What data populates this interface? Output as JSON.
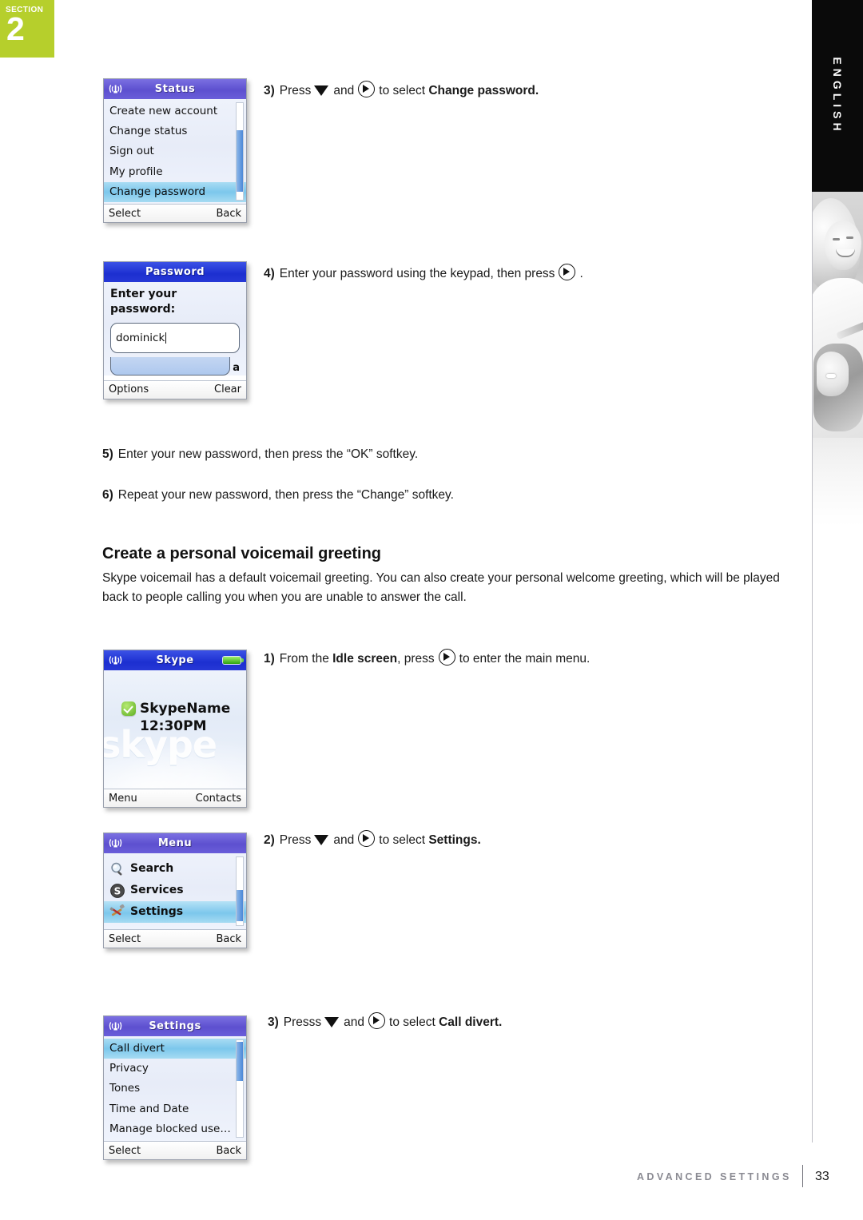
{
  "section_badge": {
    "word": "SECTION",
    "number": "2"
  },
  "rail": {
    "language": "ENGLISH"
  },
  "screens": {
    "status": {
      "title": "Status",
      "icons": {
        "signal": "antenna-icon"
      },
      "items": [
        {
          "label": "Create new account",
          "selected": false
        },
        {
          "label": "Change status",
          "selected": false
        },
        {
          "label": "Sign out",
          "selected": false
        },
        {
          "label": "My profile",
          "selected": false
        },
        {
          "label": "Change password",
          "selected": true
        }
      ],
      "softkeys": {
        "left": "Select",
        "right": "Back"
      }
    },
    "password": {
      "title": "Password",
      "prompt_line1": "Enter your",
      "prompt_line2": "password:",
      "input_value": "dominick",
      "input_mode": "a",
      "softkeys": {
        "left": "Options",
        "right": "Clear"
      }
    },
    "idle": {
      "title": "Skype",
      "icons": {
        "signal": "antenna-icon",
        "battery": "battery-icon",
        "presence": "online-check-icon"
      },
      "username": "SkypeName",
      "time": "12:30PM",
      "watermark": "skype",
      "softkeys": {
        "left": "Menu",
        "right": "Contacts"
      }
    },
    "menu": {
      "title": "Menu",
      "items": [
        {
          "label": "Search",
          "icon": "magnifier-icon",
          "selected": false
        },
        {
          "label": "Services",
          "icon": "skype-s-icon",
          "selected": false
        },
        {
          "label": "Settings",
          "icon": "tools-icon",
          "selected": true
        }
      ],
      "softkeys": {
        "left": "Select",
        "right": "Back"
      }
    },
    "settings": {
      "title": "Settings",
      "items": [
        {
          "label": "Call divert",
          "selected": true
        },
        {
          "label": "Privacy",
          "selected": false
        },
        {
          "label": "Tones",
          "selected": false
        },
        {
          "label": "Time and Date",
          "selected": false
        },
        {
          "label": "Manage blocked use…",
          "selected": false
        }
      ],
      "softkeys": {
        "left": "Select",
        "right": "Back"
      }
    }
  },
  "steps": {
    "s3_change_password": {
      "num": "3)",
      "a": "Press",
      "b": "and",
      "c": "to select",
      "bold": "Change password."
    },
    "s4_enter_password": {
      "num": "4)",
      "a": "Enter your password using the keypad, then press",
      "b": "."
    },
    "s5": {
      "num": "5)",
      "text": "Enter your new password, then press the “OK” softkey."
    },
    "s6": {
      "num": "6)",
      "text": "Repeat your new password, then press the “Change” softkey."
    },
    "s1_idle": {
      "num": "1)",
      "a": "From the",
      "bold1": "Idle screen",
      "b": ", press",
      "c": "to enter the main menu."
    },
    "s2_settings": {
      "num": "2)",
      "a": "Press",
      "b": "and",
      "c": "to select",
      "bold": "Settings."
    },
    "s3_call_divert": {
      "num": "3)",
      "a": "Presss",
      "b": "and",
      "c": "to select",
      "bold": "Call divert."
    }
  },
  "article": {
    "heading": "Create a personal voicemail greeting",
    "paragraph_line1": "Skype voicemail has a default voicemail greeting. You can also create your personal welcome greeting, which",
    "paragraph_line2": "will be played back to people calling you when you are unable to answer the call."
  },
  "footer": {
    "label": "ADVANCED SETTINGS",
    "page": "33"
  },
  "colors": {
    "section_badge": "#b6cf2c",
    "header_purple": "#5d50cf",
    "header_blue": "#1c2fd0",
    "selection_blue": "#7cc7ec",
    "battery_green": "#5fb024",
    "footer_gray": "#8a8a92"
  }
}
